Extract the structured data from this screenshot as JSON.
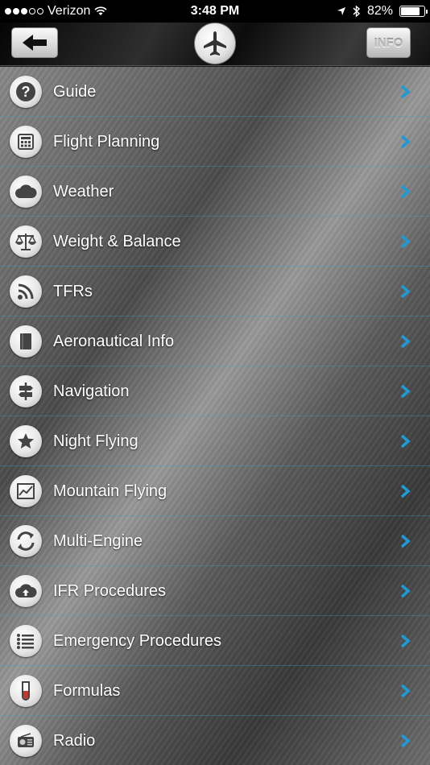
{
  "status_bar": {
    "carrier": "Verizon",
    "time": "3:48 PM",
    "battery": "82%",
    "battery_level": 0.82
  },
  "nav": {
    "back_icon": "arrow-left-icon",
    "center_icon": "airplane-icon",
    "info_label": "INFO"
  },
  "menu": {
    "items": [
      {
        "label": "Guide",
        "icon": "question-icon"
      },
      {
        "label": "Flight Planning",
        "icon": "calculator-icon"
      },
      {
        "label": "Weather",
        "icon": "cloud-icon"
      },
      {
        "label": "Weight & Balance",
        "icon": "scale-icon"
      },
      {
        "label": "TFRs",
        "icon": "rss-icon"
      },
      {
        "label": "Aeronautical Info",
        "icon": "book-icon"
      },
      {
        "label": "Navigation",
        "icon": "signpost-icon"
      },
      {
        "label": "Night Flying",
        "icon": "star-icon"
      },
      {
        "label": "Mountain Flying",
        "icon": "chart-icon"
      },
      {
        "label": "Multi-Engine",
        "icon": "sync-icon"
      },
      {
        "label": "IFR Procedures",
        "icon": "cloud-upload-icon"
      },
      {
        "label": "Emergency Procedures",
        "icon": "list-icon"
      },
      {
        "label": "Formulas",
        "icon": "test-tube-icon"
      },
      {
        "label": "Radio",
        "icon": "radio-icon"
      }
    ]
  },
  "colors": {
    "accent": "#1e9ad6",
    "divider": "#3ca0c8"
  }
}
